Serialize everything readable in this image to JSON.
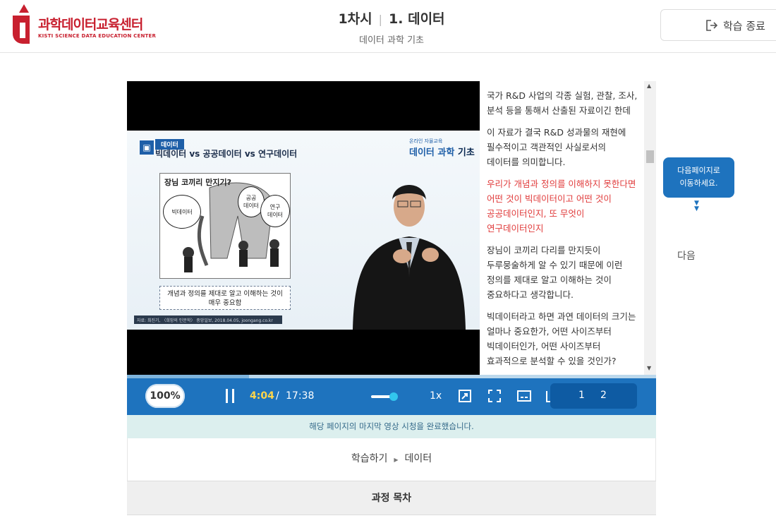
{
  "header": {
    "logo_text": "과학데이터교육센터",
    "logo_sub": "KISTI SCIENCE DATA EDUCATION CENTER",
    "session": "1차시",
    "chapter": "1. 데이터",
    "subtitle": "데이터 과학 기초",
    "end_button": "학습 종료"
  },
  "slide": {
    "tag": "데이터",
    "title": "빅데이터 vs 공공데이터 vs 연구데이터",
    "brand_small": "온라인 자율교육",
    "brand_a": "데이터 과학",
    "brand_b": " 기초",
    "cartoon_title": "장님 코끼리 만지기?",
    "bubble_big": "빅데이터",
    "bubble_public": "공공\n데이터",
    "bubble_research": "연구\n데이터",
    "caption": "개념과 정의를 제대로 알고 이해하는 것이\n매우 중요함",
    "source": "자료: 최진기, 〈희망의 인문학〉 중앙일보, 2018.04.05, joongang.co.kr"
  },
  "transcript": [
    {
      "text": "국가 R&D 사업의 각종 실험, 관찰, 조사, 분석 등을 통해서 산출된 자료이긴 한데",
      "highlight": false
    },
    {
      "text": "이 자료가 결국 R&D 성과물의 재현에 필수적이고 객관적인 사실로서의 데이터를 의미합니다.",
      "highlight": false
    },
    {
      "text": "우리가 개념과 정의를 이해하지 못한다면 어떤 것이 빅데이터이고 어떤 것이 공공데이터인지, 또 무엇이 연구데이터인지",
      "highlight": true
    },
    {
      "text": "장님이 코끼리 다리를 만지듯이 두루뭉술하게 알 수 있기 때문에 이런 정의를 제대로 알고 이해하는 것이 중요하다고 생각합니다.",
      "highlight": false
    },
    {
      "text": "빅데이터라고 하면 과연 데이터의 크기는 얼마나 중요한가, 어떤 사이즈부터 빅데이터인가, 어떤 사이즈부터 효과적으로 분석할 수 있을 것인가?",
      "highlight": false
    }
  ],
  "player": {
    "zoom": "100%",
    "current_time": "4:04",
    "separator": "/",
    "total_time": "17:38",
    "progress_fraction": 0.23,
    "speed": "1x",
    "pages": [
      "1",
      "2"
    ]
  },
  "notice": "해당 페이지의 마지막 영상 시청을 완료했습니다.",
  "breadcrumb": {
    "root": "학습하기",
    "current": "데이터"
  },
  "toc_label": "과정 목차",
  "tooltip": "다음페이지로\n이동하세요.",
  "next_label": "다음",
  "colors": {
    "brand_red": "#c8202f",
    "player_blue": "#1e73be",
    "time_yellow": "#ffd54a",
    "highlight_red": "#e03a3a"
  }
}
